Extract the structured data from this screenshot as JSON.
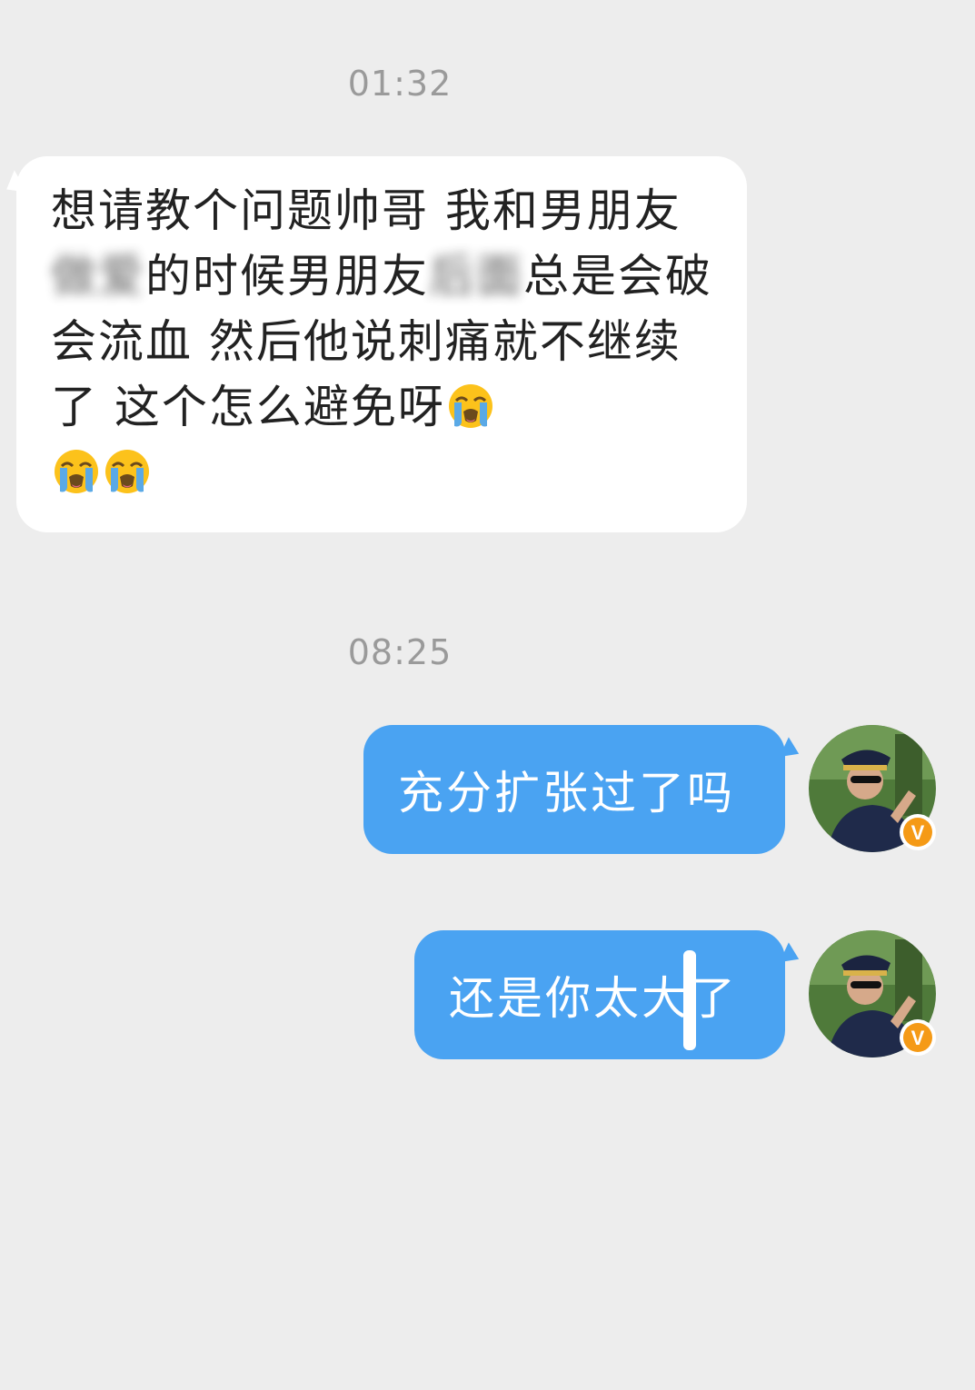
{
  "chat": {
    "timestamps": [
      "01:32",
      "08:25"
    ],
    "incoming": {
      "line_before_blur_1": "想请教个问题帅哥 我和男朋友",
      "blurred_1": "做爱",
      "line_mid": "的时候男朋友",
      "blurred_2": "后面",
      "line_after": "总是会破 会流血 然后他说刺痛就不继续了 这个怎么避免呀",
      "emoji_name": "loudly-crying-face-icon",
      "emoji_count": 3
    },
    "outgoing": [
      {
        "text": "充分扩张过了吗"
      },
      {
        "text": "还是你太大了"
      }
    ],
    "verified_badge": "V"
  },
  "colors": {
    "background": "#ededed",
    "incoming_bubble": "#ffffff",
    "outgoing_bubble": "#4aa3f2",
    "timestamp_text": "#9a9a9a",
    "badge": "#f59a16"
  }
}
